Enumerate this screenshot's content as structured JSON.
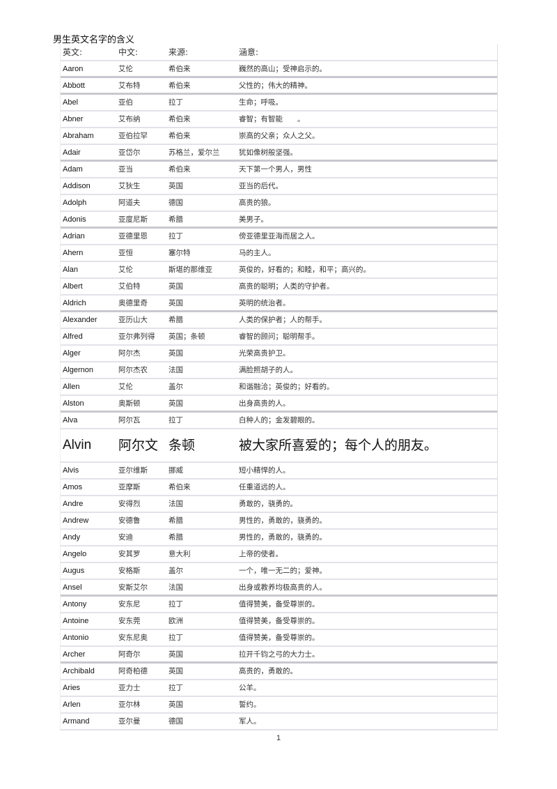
{
  "document": {
    "title": "男生英文名字的含义",
    "page_number": "1"
  },
  "table": {
    "headers": {
      "english": "英文:",
      "chinese": "中文:",
      "origin": "来源:",
      "meaning": "涵意:"
    },
    "rows": [
      {
        "english": "Aaron",
        "chinese": "艾伦",
        "origin": "希伯来",
        "meaning": "巍然的高山；受神启示的。"
      },
      {
        "english": "Abbott",
        "chinese": "艾布特",
        "origin": "希伯来",
        "meaning": "父性的；伟大的精神。"
      },
      {
        "english": "Abel",
        "chinese": "亚伯",
        "origin": "拉丁",
        "meaning": "生命；呼吸。"
      },
      {
        "english": "Abner",
        "chinese": "艾布纳",
        "origin": "希伯来",
        "meaning": "睿智；有智能　　。"
      },
      {
        "english": "Abraham",
        "chinese": "亚伯拉罕",
        "origin": "希伯来",
        "meaning": "崇高的父亲；众人之父。"
      },
      {
        "english": "Adair",
        "chinese": "亚岱尔",
        "origin": "苏格兰，爱尔兰",
        "meaning": "犹如像树般坚强。"
      },
      {
        "english": "Adam",
        "chinese": "亚当",
        "origin": "希伯来",
        "meaning": "天下第一个男人，男性"
      },
      {
        "english": "Addison",
        "chinese": "艾狄生",
        "origin": "英国",
        "meaning": "亚当的后代。"
      },
      {
        "english": "Adolph",
        "chinese": "阿道夫",
        "origin": "德国",
        "meaning": "高贵的狼。"
      },
      {
        "english": "Adonis",
        "chinese": "亚度尼斯",
        "origin": "希腊",
        "meaning": "美男子。"
      },
      {
        "english": "Adrian",
        "chinese": "亚德里恩",
        "origin": "拉丁",
        "meaning": "傍亚德里亚海而居之人。"
      },
      {
        "english": "Ahern",
        "chinese": "亚恒",
        "origin": "塞尔特",
        "meaning": "马的主人。"
      },
      {
        "english": "Alan",
        "chinese": "艾伦",
        "origin": "斯堪的那维亚",
        "meaning": "英俊的，好看的；和睦，和平；高兴的。"
      },
      {
        "english": "Albert",
        "chinese": "艾伯特",
        "origin": "英国",
        "meaning": "高贵的聪明；人类的守护者。"
      },
      {
        "english": "Aldrich",
        "chinese": "奥德里奇",
        "origin": "英国",
        "meaning": "英明的统治者。"
      },
      {
        "english": "Alexander",
        "chinese": "亚历山大",
        "origin": "希腊",
        "meaning": "人类的保护者；人的帮手。"
      },
      {
        "english": "Alfred",
        "chinese": "亚尔弗列得",
        "origin": "英国；条顿",
        "meaning": "睿智的顾问；聪明帮手。"
      },
      {
        "english": "Alger",
        "chinese": "阿尔杰",
        "origin": "英国",
        "meaning": "光荣高贵护卫。"
      },
      {
        "english": "Algernon",
        "chinese": "阿尔杰农",
        "origin": "法国",
        "meaning": "满脸照胡子的人。"
      },
      {
        "english": "Allen",
        "chinese": "艾伦",
        "origin": "盖尔",
        "meaning": "和谐融洽；英俊的；好看的。"
      },
      {
        "english": "Alston",
        "chinese": "奥斯顿",
        "origin": "英国",
        "meaning": "出身高贵的人。"
      },
      {
        "english": "Alva",
        "chinese": "阿尔瓦",
        "origin": "拉丁",
        "meaning": "白种人的；金发碧眼的。"
      },
      {
        "english": "Alvin",
        "chinese": "阿尔文",
        "origin": "条顿",
        "meaning": "被大家所喜爱的；每个人的朋友。"
      },
      {
        "english": "Alvis",
        "chinese": "亚尔维斯",
        "origin": "挪威",
        "meaning": "短小精悍的人。"
      },
      {
        "english": "Amos",
        "chinese": "亚摩斯",
        "origin": "希伯来",
        "meaning": "任重道远的人。"
      },
      {
        "english": "Andre",
        "chinese": "安得烈",
        "origin": "法国",
        "meaning": "勇敢的，骁勇的。"
      },
      {
        "english": "Andrew",
        "chinese": "安德鲁",
        "origin": "希腊",
        "meaning": "男性的，勇敢的，骁勇的。"
      },
      {
        "english": "Andy",
        "chinese": "安迪",
        "origin": "希腊",
        "meaning": "男性的，勇敢的，骁勇的。"
      },
      {
        "english": "Angelo",
        "chinese": "安其罗",
        "origin": "意大利",
        "meaning": "上帝的使者。"
      },
      {
        "english": "Augus",
        "chinese": "安格斯",
        "origin": "盖尔",
        "meaning": "一个，唯一无二的；爱神。"
      },
      {
        "english": "Ansel",
        "chinese": "安斯艾尔",
        "origin": "法国",
        "meaning": "出身或教养均极高贵的人。"
      },
      {
        "english": "Antony",
        "chinese": "安东尼",
        "origin": "拉丁",
        "meaning": "值得赞美，备受尊崇的。"
      },
      {
        "english": "Antoine",
        "chinese": "安东莞",
        "origin": "欧洲",
        "meaning": "值得赞美，备受尊崇的。"
      },
      {
        "english": "Antonio",
        "chinese": "安东尼奥",
        "origin": "拉丁",
        "meaning": "值得赞美，备受尊崇的。"
      },
      {
        "english": "Archer",
        "chinese": "阿奇尔",
        "origin": "英国",
        "meaning": "拉开千钧之弓的大力士。"
      },
      {
        "english": "Archibald",
        "chinese": "阿奇柏德",
        "origin": "英国",
        "meaning": "高贵的，勇敢的。"
      },
      {
        "english": "Aries",
        "chinese": "亚力士",
        "origin": "拉丁",
        "meaning": "公羊。"
      },
      {
        "english": "Arlen",
        "chinese": "亚尔林",
        "origin": "英国",
        "meaning": "誓约。"
      },
      {
        "english": "Armand",
        "chinese": "亚尔曼",
        "origin": "德国",
        "meaning": "军人。"
      }
    ]
  }
}
